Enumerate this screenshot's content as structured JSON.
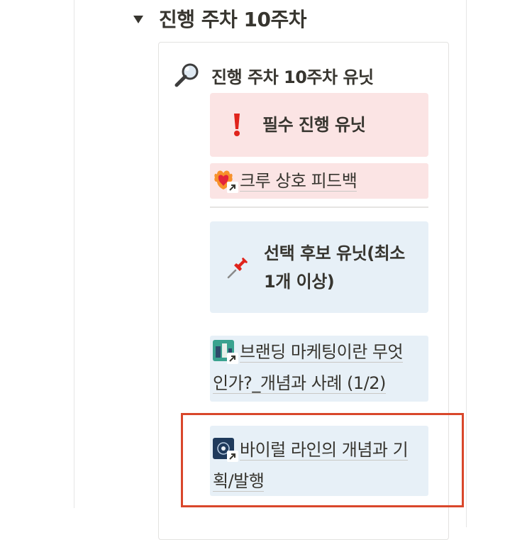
{
  "toggle": {
    "title": "진행 주차 10주차"
  },
  "units": {
    "heading": "진행 주차 10주차 유닛",
    "heading_icon": "magnifying-glass-icon",
    "required": {
      "callout_label": "필수 진행 유닛",
      "callout_icon": "exclamation-icon",
      "items": [
        {
          "label": "크루 상호 피드백",
          "icon": "heart-on-fire-icon"
        }
      ]
    },
    "optional": {
      "callout_label_line1": "선택 후보 유닛(최소",
      "callout_label_line2": "1개 이상)",
      "callout_icon": "pushpin-icon",
      "items": [
        {
          "label_line1": "브랜딩 마케팅이란 무엇",
          "label_line2": "인가?_개념과 사례 (1/2)",
          "icon": "page-thumbnail-icon"
        },
        {
          "label_line1": "바이럴 라인의 개념과 기",
          "label_line2": "획/발행",
          "icon": "page-thumbnail-icon"
        }
      ]
    }
  },
  "colors": {
    "red_callout_bg": "#fbe4e4",
    "blue_callout_bg": "#e7f0f7",
    "highlight_border": "#d9472b",
    "text": "#37352f"
  }
}
